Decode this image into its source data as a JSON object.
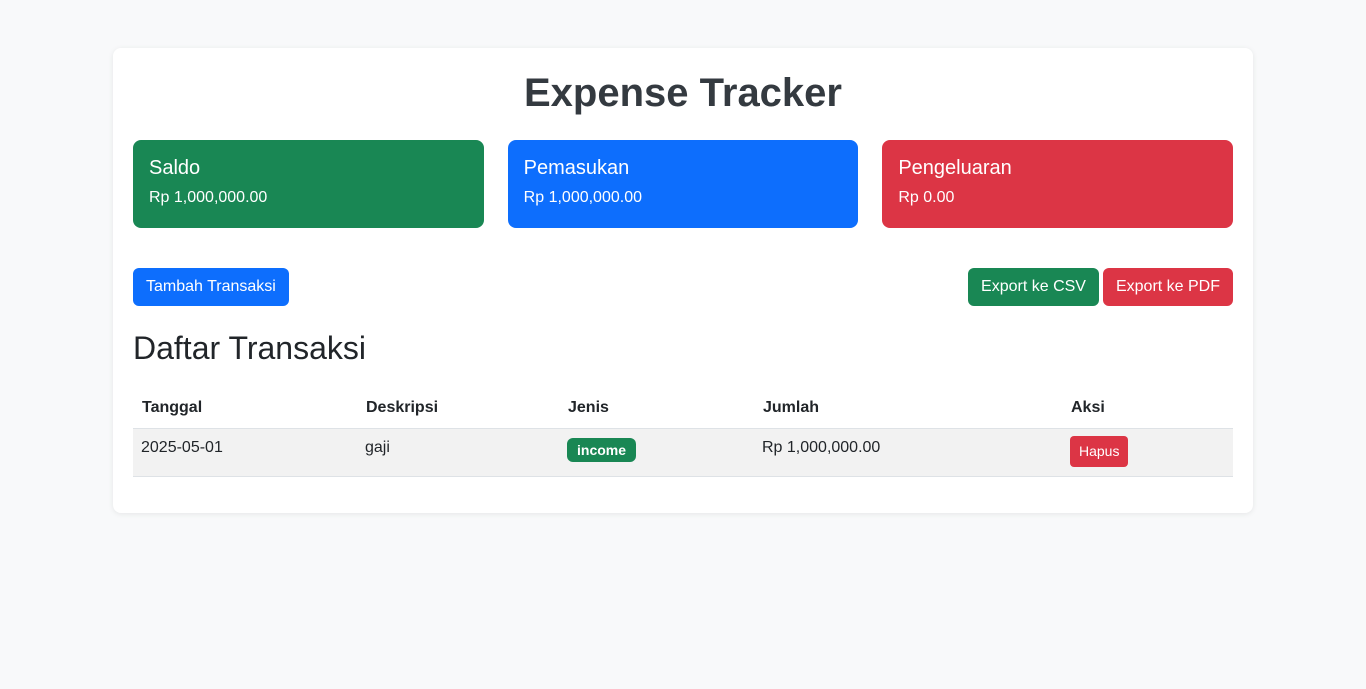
{
  "app": {
    "title": "Expense Tracker"
  },
  "colors": {
    "success": "#198754",
    "primary": "#0d6efd",
    "danger": "#dc3545"
  },
  "cards": [
    {
      "label": "Saldo",
      "value": "Rp 1,000,000.00",
      "color": "#198754"
    },
    {
      "label": "Pemasukan",
      "value": "Rp 1,000,000.00",
      "color": "#0d6efd"
    },
    {
      "label": "Pengeluaran",
      "value": "Rp 0.00",
      "color": "#dc3545"
    }
  ],
  "actions": {
    "add_label": "Tambah Transaksi",
    "export_csv_label": "Export ke CSV",
    "export_pdf_label": "Export ke PDF"
  },
  "transactions": {
    "title": "Daftar Transaksi",
    "headers": [
      "Tanggal",
      "Deskripsi",
      "Jenis",
      "Jumlah",
      "Aksi"
    ],
    "rows": [
      {
        "date": "2025-05-01",
        "description": "gaji",
        "type": "income",
        "amount": "Rp 1,000,000.00",
        "action": "Hapus"
      }
    ]
  }
}
